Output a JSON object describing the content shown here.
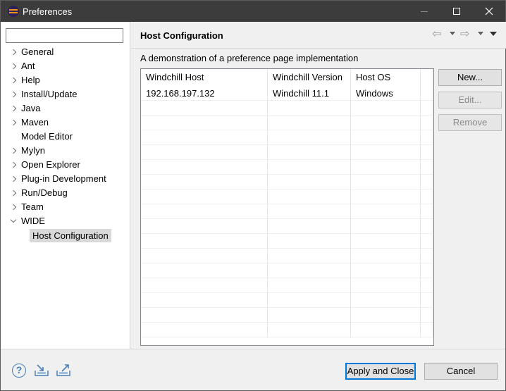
{
  "window": {
    "title": "Preferences"
  },
  "filter": {
    "value": "",
    "placeholder": ""
  },
  "tree": {
    "items": [
      {
        "label": "General",
        "expander": "collapsed"
      },
      {
        "label": "Ant",
        "expander": "collapsed"
      },
      {
        "label": "Help",
        "expander": "collapsed"
      },
      {
        "label": "Install/Update",
        "expander": "collapsed"
      },
      {
        "label": "Java",
        "expander": "collapsed"
      },
      {
        "label": "Maven",
        "expander": "collapsed"
      },
      {
        "label": "Model Editor",
        "expander": "none"
      },
      {
        "label": "Mylyn",
        "expander": "collapsed"
      },
      {
        "label": "Open Explorer",
        "expander": "collapsed"
      },
      {
        "label": "Plug-in Development",
        "expander": "collapsed"
      },
      {
        "label": "Run/Debug",
        "expander": "collapsed"
      },
      {
        "label": "Team",
        "expander": "collapsed"
      },
      {
        "label": "WIDE",
        "expander": "expanded"
      }
    ],
    "child": {
      "label": "Host Configuration",
      "selected": true
    }
  },
  "page": {
    "title": "Host Configuration",
    "description": "A demonstration of a preference page implementation"
  },
  "table": {
    "columns": [
      "Windchill Host",
      "Windchill Version",
      "Host OS"
    ],
    "rows": [
      [
        "192.168.197.132",
        "Windchill 11.1",
        "Windows"
      ]
    ]
  },
  "buttons": {
    "new": "New...",
    "edit": "Edit...",
    "remove": "Remove",
    "apply_close": "Apply and Close",
    "cancel": "Cancel"
  },
  "icons": {
    "help": "?",
    "back": "⇦",
    "forward": "⇨"
  },
  "colors": {
    "titlebar": "#3c3c3c",
    "default_button_border": "#0078d7",
    "selection": "#d9d9d9"
  }
}
